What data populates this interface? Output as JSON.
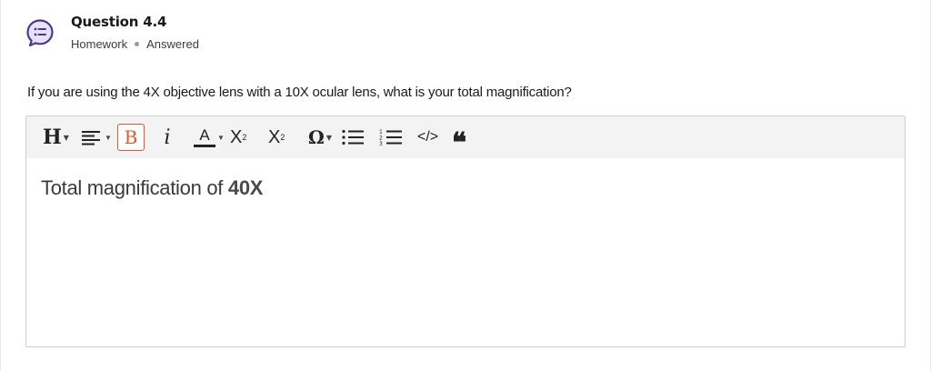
{
  "question": {
    "title": "Question 4.4",
    "type": "Homework",
    "status": "Answered",
    "text": "If you are using the 4X objective lens with a 10X ocular lens, what is your total magnification?"
  },
  "toolbar": {
    "heading": "H",
    "bold": "B",
    "italic": "i",
    "font_color": "A",
    "subscript_base": "X",
    "subscript_mark": "2",
    "superscript_base": "X",
    "superscript_mark": "2",
    "special_char": "Ω",
    "code": "</>",
    "quote": "❝",
    "active_color": "#e3572c"
  },
  "answer": {
    "text": "Total magnification of ",
    "bold_text": "40X"
  },
  "icons": {
    "question": "chat-bubble-list-icon",
    "align": "align-left-icon",
    "bullet_list": "bullet-list-icon",
    "numbered_list": "numbered-list-icon"
  },
  "colors": {
    "icon_purple": "#4b3a8c",
    "icon_fill": "#e9e2ff",
    "toolbar_bg": "#f3f3f3"
  }
}
